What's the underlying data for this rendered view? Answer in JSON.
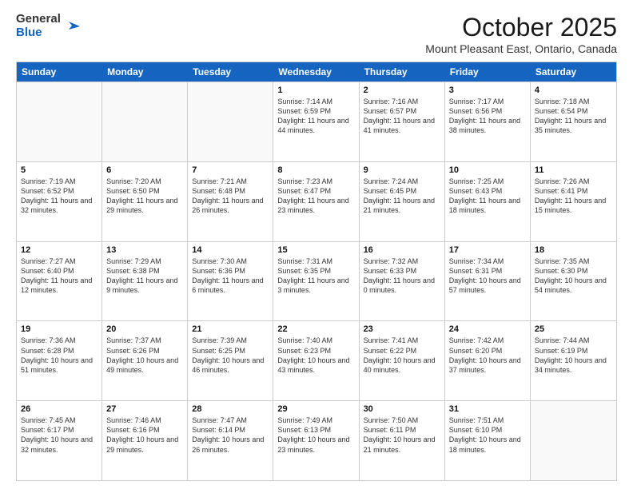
{
  "logo": {
    "general": "General",
    "blue": "Blue"
  },
  "header": {
    "month": "October 2025",
    "location": "Mount Pleasant East, Ontario, Canada"
  },
  "weekdays": [
    "Sunday",
    "Monday",
    "Tuesday",
    "Wednesday",
    "Thursday",
    "Friday",
    "Saturday"
  ],
  "weeks": [
    [
      {
        "day": "",
        "text": ""
      },
      {
        "day": "",
        "text": ""
      },
      {
        "day": "",
        "text": ""
      },
      {
        "day": "1",
        "text": "Sunrise: 7:14 AM\nSunset: 6:59 PM\nDaylight: 11 hours and 44 minutes."
      },
      {
        "day": "2",
        "text": "Sunrise: 7:16 AM\nSunset: 6:57 PM\nDaylight: 11 hours and 41 minutes."
      },
      {
        "day": "3",
        "text": "Sunrise: 7:17 AM\nSunset: 6:56 PM\nDaylight: 11 hours and 38 minutes."
      },
      {
        "day": "4",
        "text": "Sunrise: 7:18 AM\nSunset: 6:54 PM\nDaylight: 11 hours and 35 minutes."
      }
    ],
    [
      {
        "day": "5",
        "text": "Sunrise: 7:19 AM\nSunset: 6:52 PM\nDaylight: 11 hours and 32 minutes."
      },
      {
        "day": "6",
        "text": "Sunrise: 7:20 AM\nSunset: 6:50 PM\nDaylight: 11 hours and 29 minutes."
      },
      {
        "day": "7",
        "text": "Sunrise: 7:21 AM\nSunset: 6:48 PM\nDaylight: 11 hours and 26 minutes."
      },
      {
        "day": "8",
        "text": "Sunrise: 7:23 AM\nSunset: 6:47 PM\nDaylight: 11 hours and 23 minutes."
      },
      {
        "day": "9",
        "text": "Sunrise: 7:24 AM\nSunset: 6:45 PM\nDaylight: 11 hours and 21 minutes."
      },
      {
        "day": "10",
        "text": "Sunrise: 7:25 AM\nSunset: 6:43 PM\nDaylight: 11 hours and 18 minutes."
      },
      {
        "day": "11",
        "text": "Sunrise: 7:26 AM\nSunset: 6:41 PM\nDaylight: 11 hours and 15 minutes."
      }
    ],
    [
      {
        "day": "12",
        "text": "Sunrise: 7:27 AM\nSunset: 6:40 PM\nDaylight: 11 hours and 12 minutes."
      },
      {
        "day": "13",
        "text": "Sunrise: 7:29 AM\nSunset: 6:38 PM\nDaylight: 11 hours and 9 minutes."
      },
      {
        "day": "14",
        "text": "Sunrise: 7:30 AM\nSunset: 6:36 PM\nDaylight: 11 hours and 6 minutes."
      },
      {
        "day": "15",
        "text": "Sunrise: 7:31 AM\nSunset: 6:35 PM\nDaylight: 11 hours and 3 minutes."
      },
      {
        "day": "16",
        "text": "Sunrise: 7:32 AM\nSunset: 6:33 PM\nDaylight: 11 hours and 0 minutes."
      },
      {
        "day": "17",
        "text": "Sunrise: 7:34 AM\nSunset: 6:31 PM\nDaylight: 10 hours and 57 minutes."
      },
      {
        "day": "18",
        "text": "Sunrise: 7:35 AM\nSunset: 6:30 PM\nDaylight: 10 hours and 54 minutes."
      }
    ],
    [
      {
        "day": "19",
        "text": "Sunrise: 7:36 AM\nSunset: 6:28 PM\nDaylight: 10 hours and 51 minutes."
      },
      {
        "day": "20",
        "text": "Sunrise: 7:37 AM\nSunset: 6:26 PM\nDaylight: 10 hours and 49 minutes."
      },
      {
        "day": "21",
        "text": "Sunrise: 7:39 AM\nSunset: 6:25 PM\nDaylight: 10 hours and 46 minutes."
      },
      {
        "day": "22",
        "text": "Sunrise: 7:40 AM\nSunset: 6:23 PM\nDaylight: 10 hours and 43 minutes."
      },
      {
        "day": "23",
        "text": "Sunrise: 7:41 AM\nSunset: 6:22 PM\nDaylight: 10 hours and 40 minutes."
      },
      {
        "day": "24",
        "text": "Sunrise: 7:42 AM\nSunset: 6:20 PM\nDaylight: 10 hours and 37 minutes."
      },
      {
        "day": "25",
        "text": "Sunrise: 7:44 AM\nSunset: 6:19 PM\nDaylight: 10 hours and 34 minutes."
      }
    ],
    [
      {
        "day": "26",
        "text": "Sunrise: 7:45 AM\nSunset: 6:17 PM\nDaylight: 10 hours and 32 minutes."
      },
      {
        "day": "27",
        "text": "Sunrise: 7:46 AM\nSunset: 6:16 PM\nDaylight: 10 hours and 29 minutes."
      },
      {
        "day": "28",
        "text": "Sunrise: 7:47 AM\nSunset: 6:14 PM\nDaylight: 10 hours and 26 minutes."
      },
      {
        "day": "29",
        "text": "Sunrise: 7:49 AM\nSunset: 6:13 PM\nDaylight: 10 hours and 23 minutes."
      },
      {
        "day": "30",
        "text": "Sunrise: 7:50 AM\nSunset: 6:11 PM\nDaylight: 10 hours and 21 minutes."
      },
      {
        "day": "31",
        "text": "Sunrise: 7:51 AM\nSunset: 6:10 PM\nDaylight: 10 hours and 18 minutes."
      },
      {
        "day": "",
        "text": ""
      }
    ]
  ]
}
